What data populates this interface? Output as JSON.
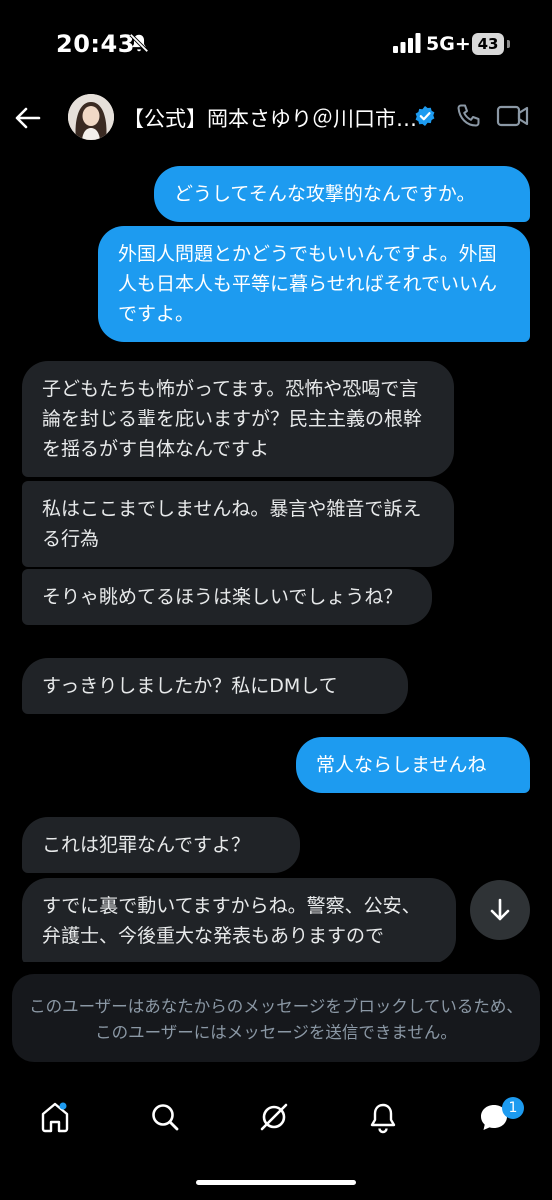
{
  "status": {
    "time": "20:43",
    "network": "5G+",
    "battery": "43"
  },
  "header": {
    "title": "【公式】岡本さゆり＠川口市…"
  },
  "messages": [
    {
      "dir": "out",
      "text": "どうしてそんな攻撃的なんですか。"
    },
    {
      "dir": "out",
      "text": "外国人問題とかどうでもいいんですよ。外国人も日本人も平等に暮らせればそれでいいんですよ。"
    },
    {
      "dir": "in",
      "text": "子どもたちも怖がってます。恐怖や恐喝で言論を封じる輩を庇いますが？民主主義の根幹を揺るがす自体なんですよ"
    },
    {
      "dir": "in",
      "text": "私はここまでしませんね。暴言や雑音で訴える行為"
    },
    {
      "dir": "in",
      "text": "そりゃ眺めてるほうは楽しいでしょうね？"
    },
    {
      "dir": "in",
      "text": "すっきりしましたか？私にDMして"
    },
    {
      "dir": "out",
      "text": "常人ならしませんね"
    },
    {
      "dir": "in",
      "text": "これは犯罪なんですよ？"
    },
    {
      "dir": "in",
      "text": "すでに裏で動いてますからね。警察、公安、弁護士、今後重大な発表もありますので"
    }
  ],
  "notice": "このユーザーはあなたからのメッセージをブロックしているため、このユーザーにはメッセージを送信できません。",
  "nav": {
    "items": [
      "home-icon",
      "search-icon",
      "grok-icon",
      "notifications-icon",
      "messages-icon"
    ],
    "messages_badge": "1"
  },
  "colors": {
    "accent": "#1d9bf0",
    "incoming_bubble": "#202327",
    "background": "#000000"
  }
}
